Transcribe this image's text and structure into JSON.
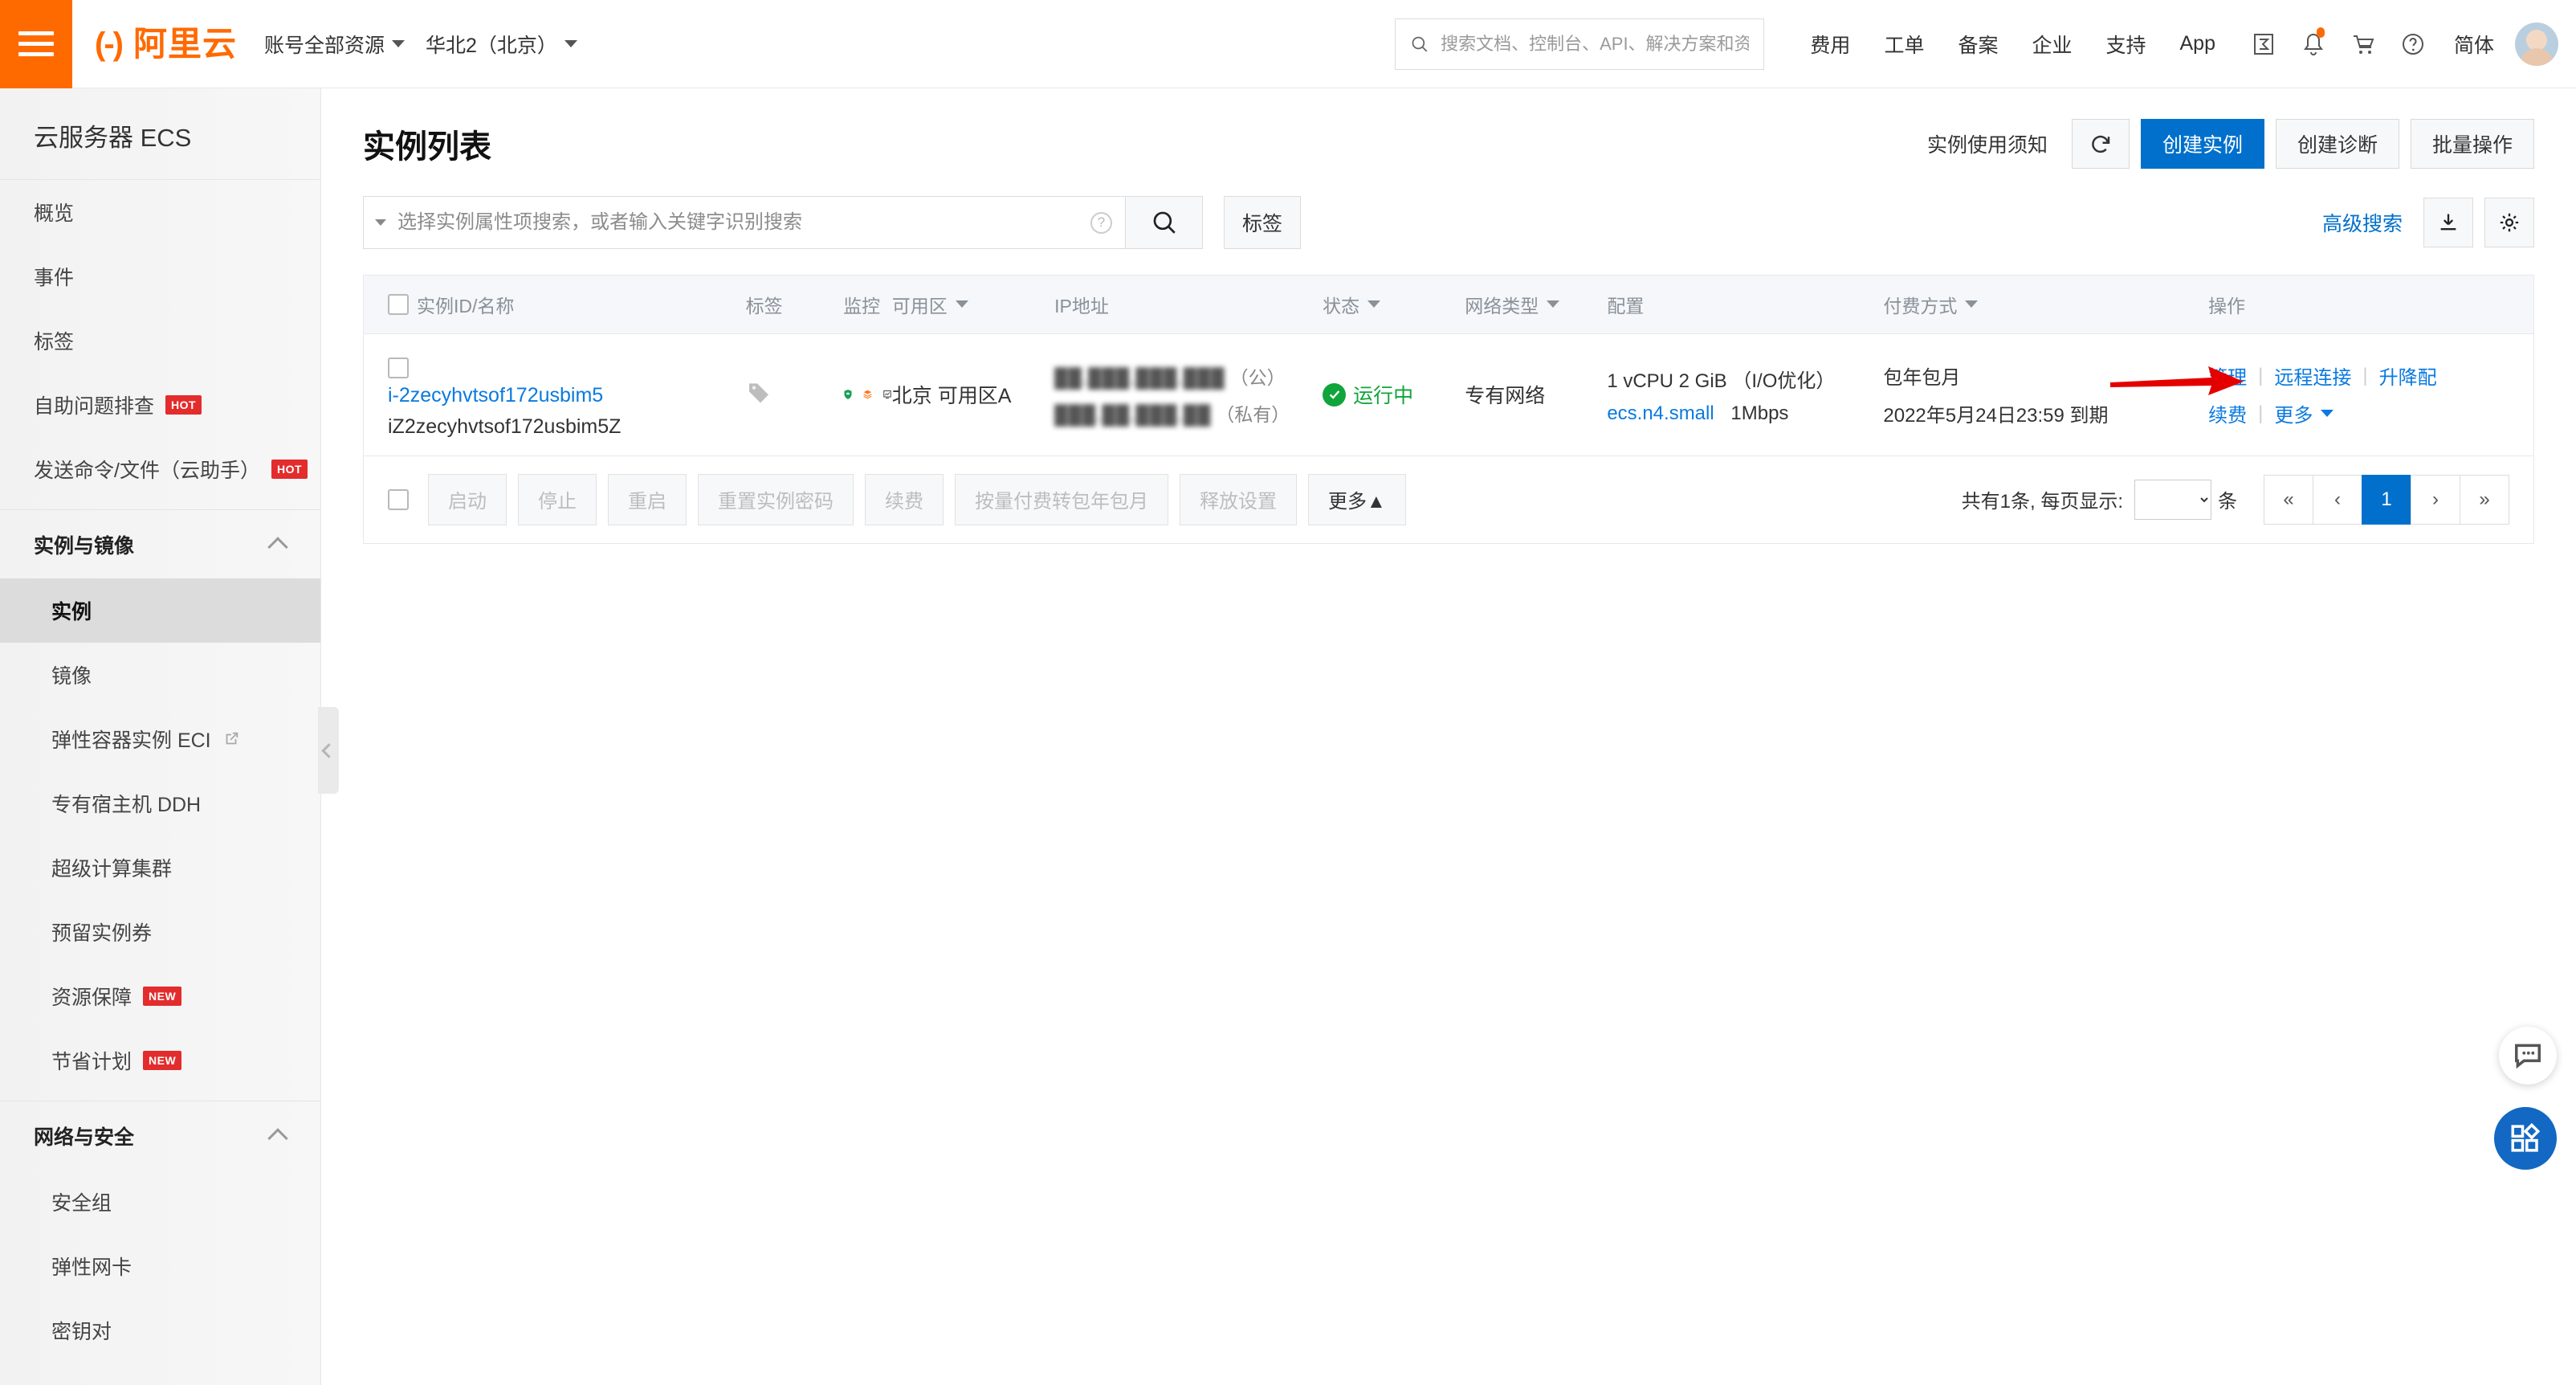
{
  "topbar": {
    "menu_icon": "hamburger-icon",
    "logo_mark": "(-)",
    "logo_text": "阿里云",
    "resource_selector": "账号全部资源",
    "region_selector": "华北2（北京）",
    "search_placeholder": "搜索文档、控制台、API、解决方案和资",
    "links": [
      "费用",
      "工单",
      "备案",
      "企业",
      "支持",
      "App"
    ],
    "icons": [
      "console-sigma-icon",
      "bell-icon",
      "cart-icon",
      "help-circle-icon"
    ],
    "language": "简体",
    "avatar": "user-avatar"
  },
  "sidebar": {
    "title": "云服务器 ECS",
    "items": [
      {
        "label": "概览"
      },
      {
        "label": "事件"
      },
      {
        "label": "标签"
      },
      {
        "label": "自助问题排查",
        "badge": "HOT"
      },
      {
        "label": "发送命令/文件（云助手）",
        "badge": "HOT"
      }
    ],
    "groups": [
      {
        "label": "实例与镜像",
        "expanded": true,
        "items": [
          {
            "label": "实例",
            "active": true
          },
          {
            "label": "镜像"
          },
          {
            "label": "弹性容器实例 ECI",
            "external": true
          },
          {
            "label": "专有宿主机 DDH"
          },
          {
            "label": "超级计算集群"
          },
          {
            "label": "预留实例券"
          },
          {
            "label": "资源保障",
            "badge": "NEW"
          },
          {
            "label": "节省计划",
            "badge": "NEW"
          }
        ]
      },
      {
        "label": "网络与安全",
        "expanded": true,
        "items": [
          {
            "label": "安全组"
          },
          {
            "label": "弹性网卡"
          },
          {
            "label": "密钥对"
          }
        ]
      }
    ],
    "collapse_handle": "collapse-sidebar-icon"
  },
  "page": {
    "title": "实例列表",
    "notice_link": "实例使用须知",
    "refresh_icon": "refresh-icon",
    "create_instance": "创建实例",
    "create_diagnosis": "创建诊断",
    "batch_operation": "批量操作"
  },
  "filter": {
    "search_placeholder": "选择实例属性项搜索，或者输入关键字识别搜索",
    "search_value": "",
    "help_icon": "question-mark-icon",
    "search_button_icon": "search-icon",
    "tag_button": "标签",
    "advanced_search": "高级搜索",
    "download_icon": "download-icon",
    "settings_icon": "gear-icon"
  },
  "table": {
    "columns": [
      {
        "label": "实例ID/名称",
        "sortable": false
      },
      {
        "label": "标签",
        "sortable": false
      },
      {
        "label": "监控",
        "sortable": false
      },
      {
        "label": "可用区",
        "sortable": true
      },
      {
        "label": "IP地址",
        "sortable": false
      },
      {
        "label": "状态",
        "sortable": true
      },
      {
        "label": "网络类型",
        "sortable": true
      },
      {
        "label": "配置",
        "sortable": false
      },
      {
        "label": "付费方式",
        "sortable": true
      },
      {
        "label": "操作",
        "sortable": false
      }
    ],
    "rows": [
      {
        "instance_id": "i-2zecyhvtsof172usbim5",
        "instance_name": "iZ2zecyhvtsof172usbim5Z",
        "tag_icon": "tag-icon",
        "monitor_icons": [
          "shield-security-icon",
          "stack-orange-icon",
          "monitor-chart-icon"
        ],
        "zone": "北京 可用区A",
        "ip_public_masked": "██.███.███.███",
        "ip_public_suffix": "（公）",
        "ip_private_masked": "███.██.███.██",
        "ip_private_suffix": "（私有）",
        "status": "运行中",
        "status_icon": "check-circle-icon",
        "network_type": "专有网络",
        "config_line1": "1 vCPU 2 GiB （I/O优化）",
        "config_type": "ecs.n4.small",
        "config_bandwidth": "1Mbps",
        "pay_type": "包年包月",
        "pay_expire": "2022年5月24日23:59 到期",
        "actions_row1": [
          "管理",
          "远程连接",
          "升降配"
        ],
        "actions_row2": [
          "续费",
          "更多"
        ]
      }
    ]
  },
  "footer": {
    "buttons": [
      {
        "label": "启动",
        "enabled": false
      },
      {
        "label": "停止",
        "enabled": false
      },
      {
        "label": "重启",
        "enabled": false
      },
      {
        "label": "重置实例密码",
        "enabled": false
      },
      {
        "label": "续费",
        "enabled": false
      },
      {
        "label": "按量付费转包年包月",
        "enabled": false
      },
      {
        "label": "释放设置",
        "enabled": false
      },
      {
        "label": "更多▲",
        "enabled": true
      }
    ],
    "total_text": "共有1条, 每页显示:",
    "page_size_value": "",
    "unit": "条",
    "pages": [
      "«",
      "‹",
      "1",
      "›",
      "»"
    ],
    "current_page": "1"
  },
  "floating": {
    "chat_icon": "chat-bubble-icon",
    "apps_icon": "app-grid-icon"
  },
  "colors": {
    "brand_orange": "#ff6a00",
    "primary_blue": "#0070cc",
    "link_blue": "#0a7ae0",
    "success_green": "#10a53a",
    "badge_red": "#e32c2c",
    "annotation_red": "#e50000"
  }
}
